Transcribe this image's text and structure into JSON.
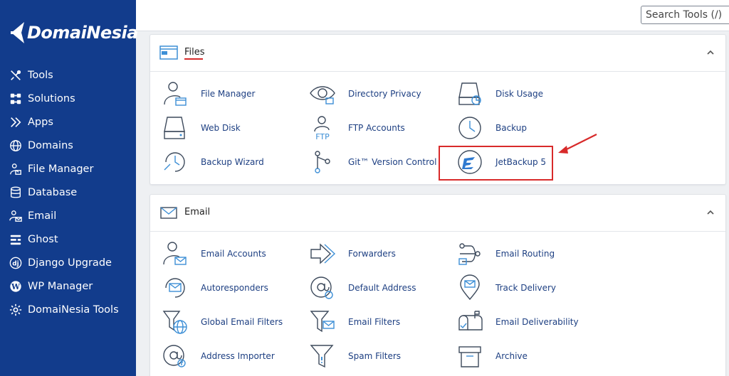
{
  "brand": {
    "name": "DomaiNesia"
  },
  "search": {
    "placeholder": "Search Tools (/)"
  },
  "sidebar": {
    "items": [
      {
        "label": "Tools",
        "icon": "tools-icon"
      },
      {
        "label": "Solutions",
        "icon": "solutions-icon"
      },
      {
        "label": "Apps",
        "icon": "apps-icon"
      },
      {
        "label": "Domains",
        "icon": "globe-icon"
      },
      {
        "label": "File Manager",
        "icon": "file-manager-icon"
      },
      {
        "label": "Database",
        "icon": "database-icon"
      },
      {
        "label": "Email",
        "icon": "email-icon"
      },
      {
        "label": "Ghost",
        "icon": "ghost-icon"
      },
      {
        "label": "Django Upgrade",
        "icon": "django-icon"
      },
      {
        "label": "WP Manager",
        "icon": "wordpress-icon"
      },
      {
        "label": "DomaiNesia Tools",
        "icon": "gear-icon"
      }
    ]
  },
  "files": {
    "title": "Files",
    "tools": [
      {
        "label": "File Manager",
        "icon": "file-manager-icon"
      },
      {
        "label": "Directory Privacy",
        "icon": "eye-icon"
      },
      {
        "label": "Disk Usage",
        "icon": "disk-usage-icon"
      },
      {
        "label": "Web Disk",
        "icon": "web-disk-icon"
      },
      {
        "label": "FTP Accounts",
        "icon": "ftp-icon"
      },
      {
        "label": "Backup",
        "icon": "backup-icon"
      },
      {
        "label": "Backup Wizard",
        "icon": "backup-wizard-icon"
      },
      {
        "label": "Git™ Version Control",
        "icon": "git-icon"
      },
      {
        "label": "JetBackup 5",
        "icon": "jetbackup-icon"
      }
    ]
  },
  "email": {
    "title": "Email",
    "tools": [
      {
        "label": "Email Accounts",
        "icon": "email-accounts-icon"
      },
      {
        "label": "Forwarders",
        "icon": "forwarders-icon"
      },
      {
        "label": "Email Routing",
        "icon": "email-routing-icon"
      },
      {
        "label": "Autoresponders",
        "icon": "autoresponders-icon"
      },
      {
        "label": "Default Address",
        "icon": "at-icon"
      },
      {
        "label": "Track Delivery",
        "icon": "track-delivery-icon"
      },
      {
        "label": "Global Email Filters",
        "icon": "global-filter-icon"
      },
      {
        "label": "Email Filters",
        "icon": "email-filter-icon"
      },
      {
        "label": "Email Deliverability",
        "icon": "mailbox-icon"
      },
      {
        "label": "Address Importer",
        "icon": "address-importer-icon"
      },
      {
        "label": "Spam Filters",
        "icon": "spam-filter-icon"
      },
      {
        "label": "Archive",
        "icon": "archive-icon"
      }
    ]
  },
  "colors": {
    "sidebar": "#123c8c",
    "link": "#1d3f82",
    "icon": "#3d4a5c",
    "accent": "#3d8fd6",
    "highlight": "#d82a2a"
  }
}
